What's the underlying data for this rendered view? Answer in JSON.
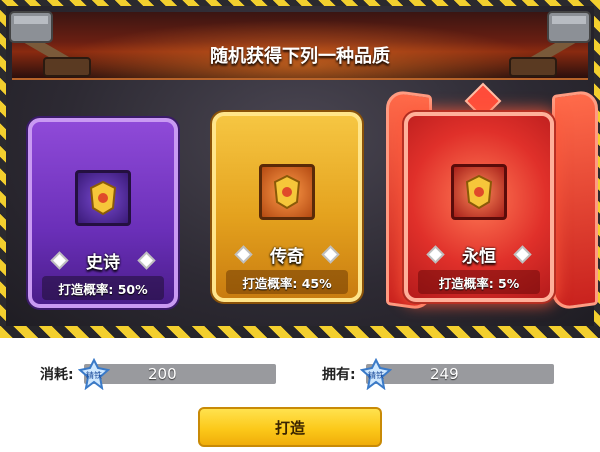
{
  "title": "随机获得下列一种品质",
  "cards": [
    {
      "name": "史诗",
      "rate": "打造概率: 50%",
      "rate_value": 0.5
    },
    {
      "name": "传奇",
      "rate": "打造概率: 45%",
      "rate_value": 0.45
    },
    {
      "name": "永恒",
      "rate": "打造概率: 5%",
      "rate_value": 0.05
    }
  ],
  "cost": {
    "label": "消耗:",
    "value": "200",
    "icon_text": "精铁"
  },
  "owned": {
    "label": "拥有:",
    "value": "249",
    "icon_text": "精铁"
  },
  "forge_button": "打造",
  "colors": {
    "epic": "#7a3cc8",
    "legendary": "#e8a81e",
    "eternal": "#e0302a",
    "button": "#fcc91a"
  }
}
